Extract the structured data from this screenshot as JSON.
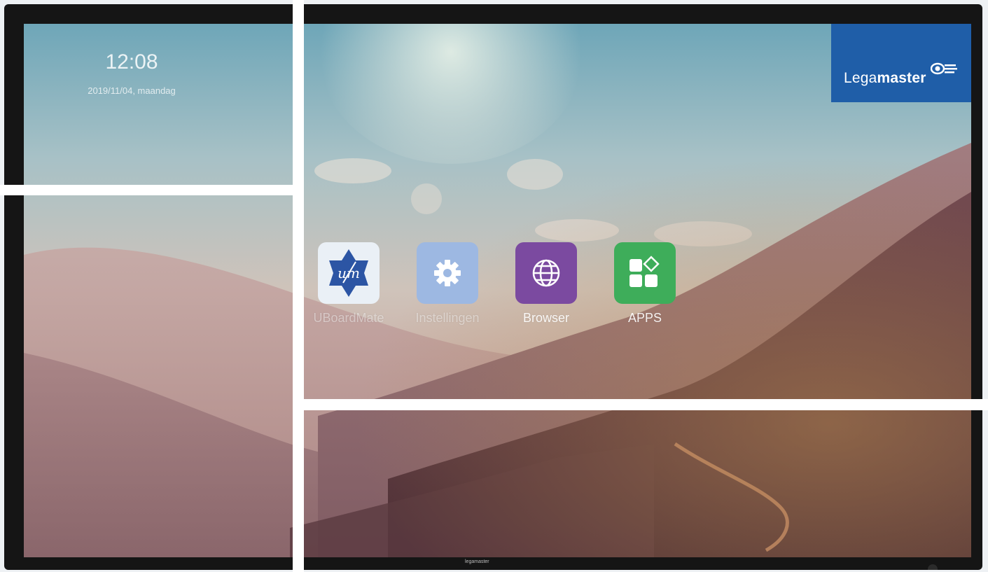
{
  "clock": {
    "time": "12:08",
    "date": "2019/11/04, maandag"
  },
  "brand": {
    "name_regular": "Lega",
    "name_bold": "master",
    "icon": "eye-logo-icon",
    "color": "#1f5ea8"
  },
  "apps": [
    {
      "label": "UBoardMate",
      "icon": "uboardmate-icon",
      "color": "#2c55a4"
    },
    {
      "label": "Instellingen",
      "icon": "gear-icon",
      "color": "#9db8e2"
    },
    {
      "label": "Browser",
      "icon": "globe-icon",
      "color": "#7b4aa0"
    },
    {
      "label": "APPS",
      "icon": "apps-grid-icon",
      "color": "#3ead5a"
    }
  ],
  "bezel_logo": "legamaster"
}
